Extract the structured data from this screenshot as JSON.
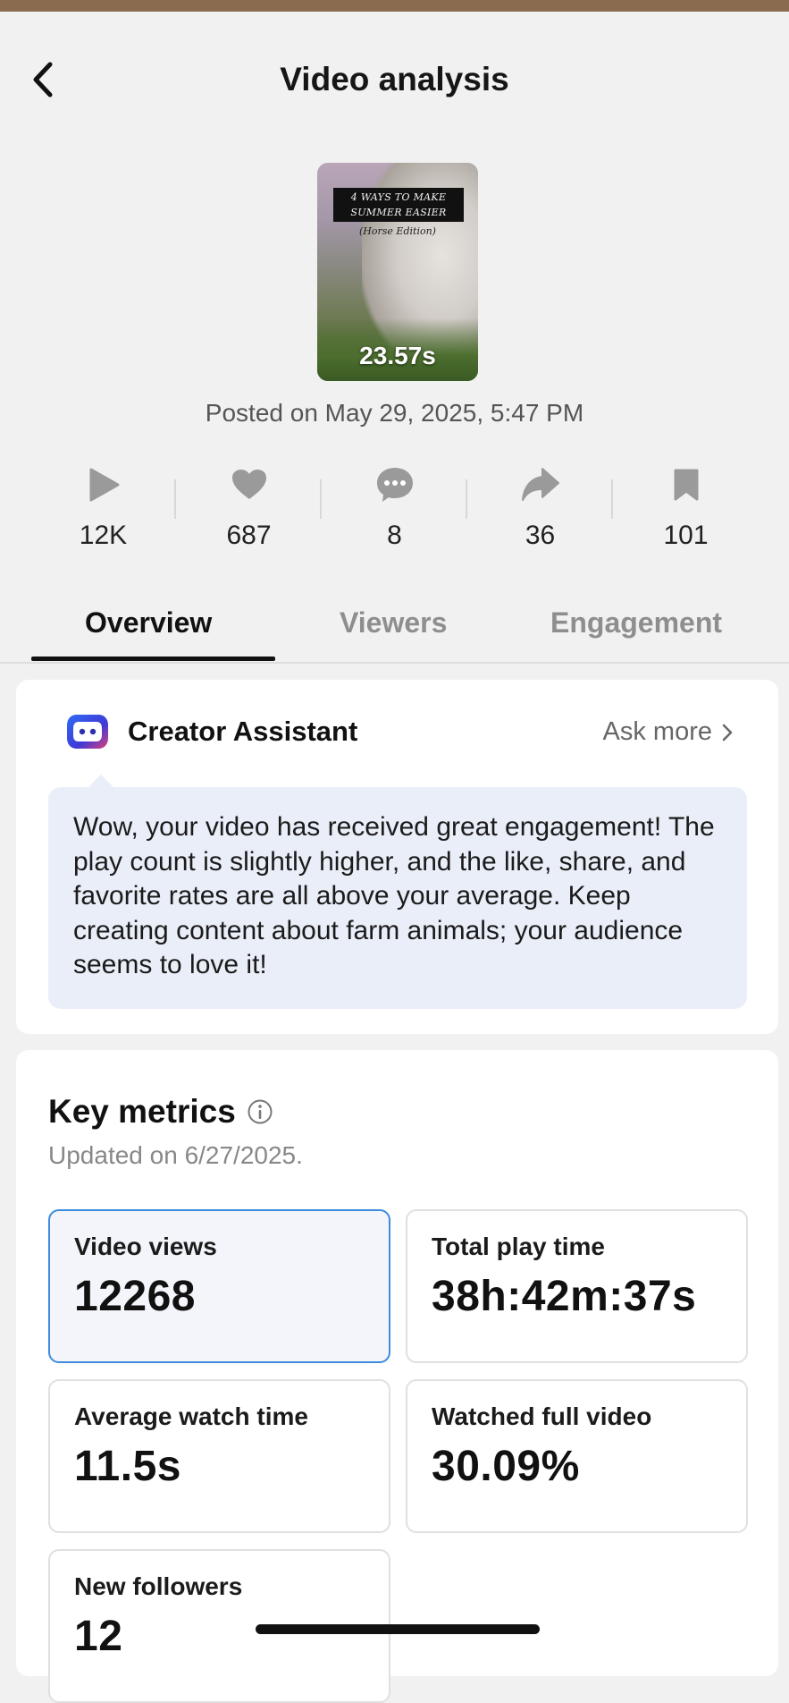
{
  "header": {
    "title": "Video analysis",
    "back_icon": "chevron-left-icon"
  },
  "video": {
    "thumbnail_caption_line1": "4 WAYS TO MAKE",
    "thumbnail_caption_line2": "SUMMER EASIER",
    "thumbnail_caption_sub": "(Horse Edition)",
    "duration": "23.57s",
    "posted": "Posted on May 29, 2025, 5:47 PM"
  },
  "stats": [
    {
      "icon": "play-icon",
      "value": "12K"
    },
    {
      "icon": "heart-icon",
      "value": "687"
    },
    {
      "icon": "comment-icon",
      "value": "8"
    },
    {
      "icon": "share-icon",
      "value": "36"
    },
    {
      "icon": "bookmark-icon",
      "value": "101"
    }
  ],
  "tabs": [
    {
      "label": "Overview",
      "active": true
    },
    {
      "label": "Viewers",
      "active": false
    },
    {
      "label": "Engagement",
      "active": false
    }
  ],
  "assistant": {
    "name": "Creator Assistant",
    "ask_more": "Ask more",
    "message": "Wow, your video has received great engagement! The play count is slightly higher, and the like, share, and favorite rates are all above your average. Keep creating content about farm animals; your audience seems to love it!"
  },
  "metrics": {
    "title": "Key metrics",
    "updated": "Updated on 6/27/2025.",
    "items": [
      {
        "label": "Video views",
        "value": "12268",
        "selected": true
      },
      {
        "label": "Total play time",
        "value": "38h:42m:37s",
        "selected": false
      },
      {
        "label": "Average watch time",
        "value": "11.5s",
        "selected": false
      },
      {
        "label": "Watched full video",
        "value": "30.09%",
        "selected": false
      },
      {
        "label": "New followers",
        "value": "12",
        "selected": false
      }
    ]
  },
  "colors": {
    "accent_border": "#3d8bdc",
    "bubble_bg": "#e9eef8",
    "stat_icon": "#9a9a9a"
  }
}
